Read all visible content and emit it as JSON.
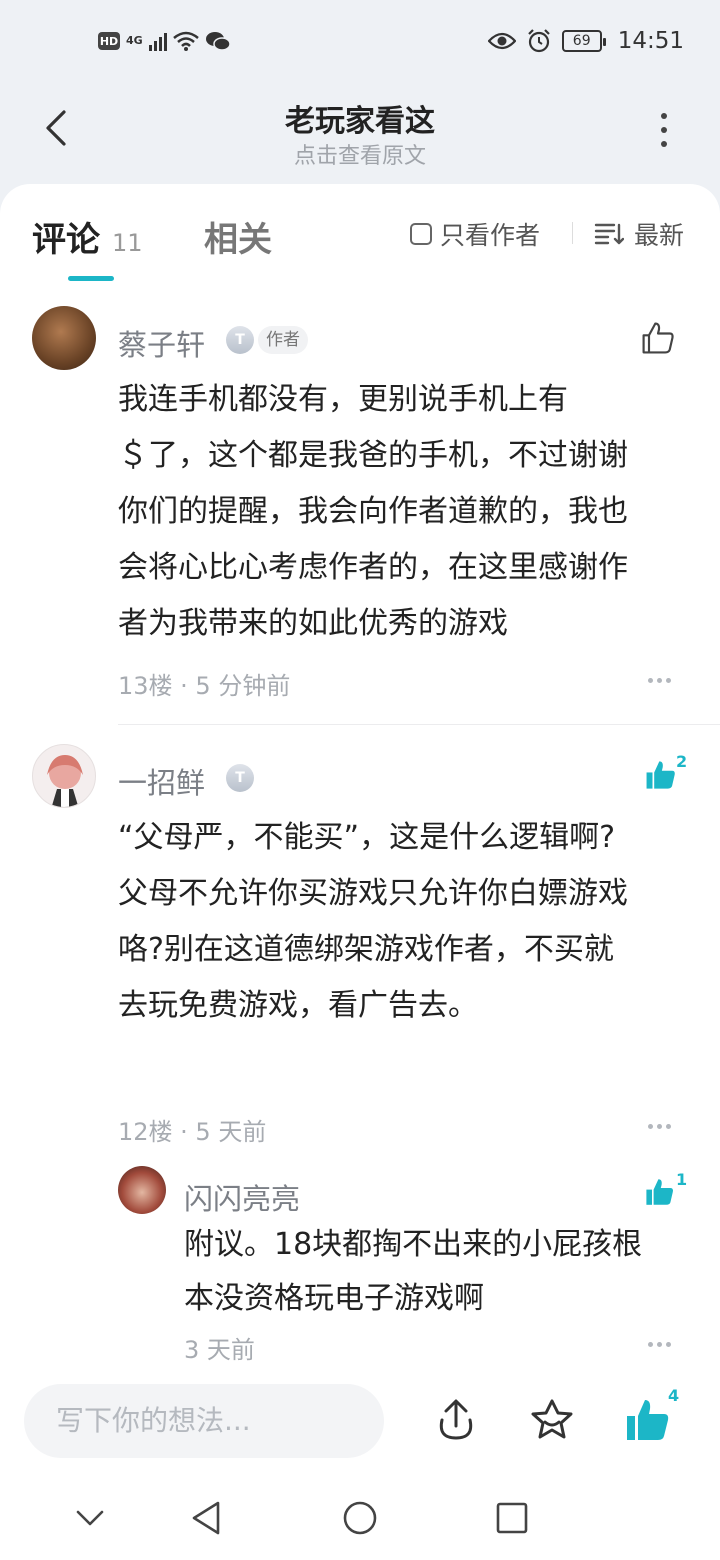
{
  "status_bar": {
    "hd": "HD",
    "network": "4G",
    "battery": "69",
    "time": "14:51"
  },
  "header": {
    "title": "老玩家看这",
    "subtitle": "点击查看原文"
  },
  "tabs": {
    "comments_label": "评论",
    "comments_count": "11",
    "related_label": "相关",
    "author_only_label": "只看作者",
    "sort_label": "最新"
  },
  "comments": [
    {
      "name": "蔡子轩",
      "level": "T",
      "author_tag": "作者",
      "lines": [
        "我连手机都没有，更别说手机上有",
        "＄了，这个都是我爸的手机，不过谢谢",
        "你们的提醒，我会向作者道歉的，我也",
        "会将心比心考虑作者的，在这里感谢作",
        "者为我带来的如此优秀的游戏"
      ],
      "meta": "13楼 · 5 分钟前",
      "likes": ""
    },
    {
      "name": "一招鲜",
      "level": "T",
      "lines": [
        "“父母严，不能买”，这是什么逻辑啊?",
        "父母不允许你买游戏只允许你白嫖游戏",
        "咯?别在这道德绑架游戏作者，不买就",
        "去玩免费游戏，看广告去。"
      ],
      "meta": "12楼 · 5 天前",
      "likes": "2"
    }
  ],
  "reply": {
    "name": "闪闪亮亮",
    "lines": [
      "附议。18块都掏不出来的小屁孩根",
      "本没资格玩电子游戏啊"
    ],
    "meta": "3 天前",
    "likes": "1"
  },
  "bottom_bar": {
    "input_placeholder": "写下你的想法...",
    "like_count": "4"
  },
  "icons": [
    "back-icon",
    "more-icon",
    "sort-icon",
    "like-icon",
    "share-icon",
    "favorite-icon",
    "nav-back-icon",
    "nav-home-icon",
    "nav-recent-icon"
  ],
  "colors": {
    "accent": "#1cb6c7",
    "background": "#eef1f5"
  }
}
